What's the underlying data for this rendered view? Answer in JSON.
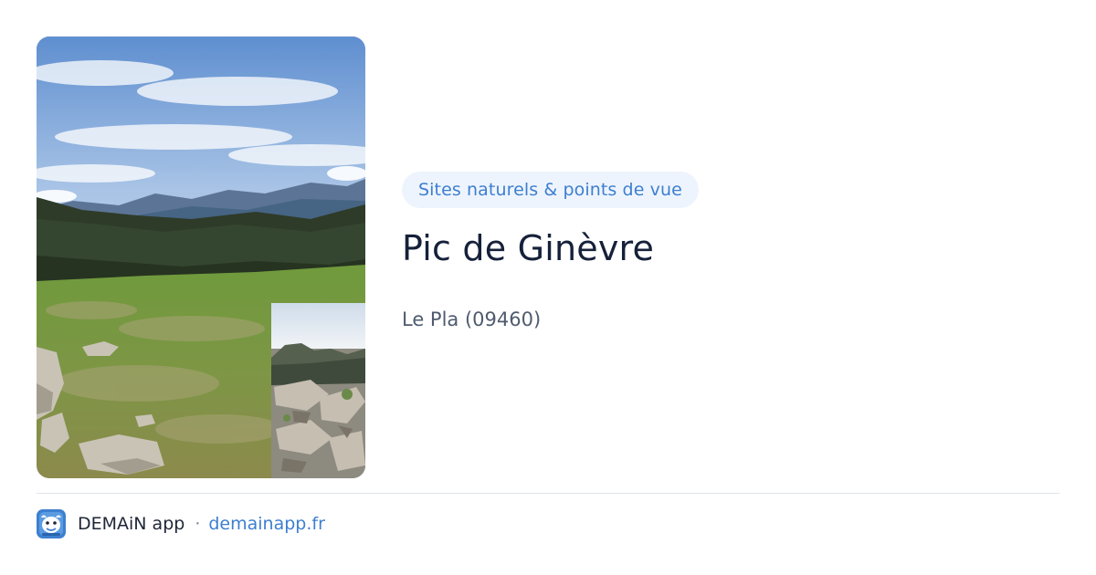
{
  "preview": {
    "category": "Sites naturels & points de vue",
    "title": "Pic de Ginèvre",
    "location": "Le Pla (09460)"
  },
  "footer": {
    "app_name": "DEMAiN app",
    "separator": "·",
    "link": "demainapp.fr",
    "accent_color": "#3d7fd0"
  }
}
